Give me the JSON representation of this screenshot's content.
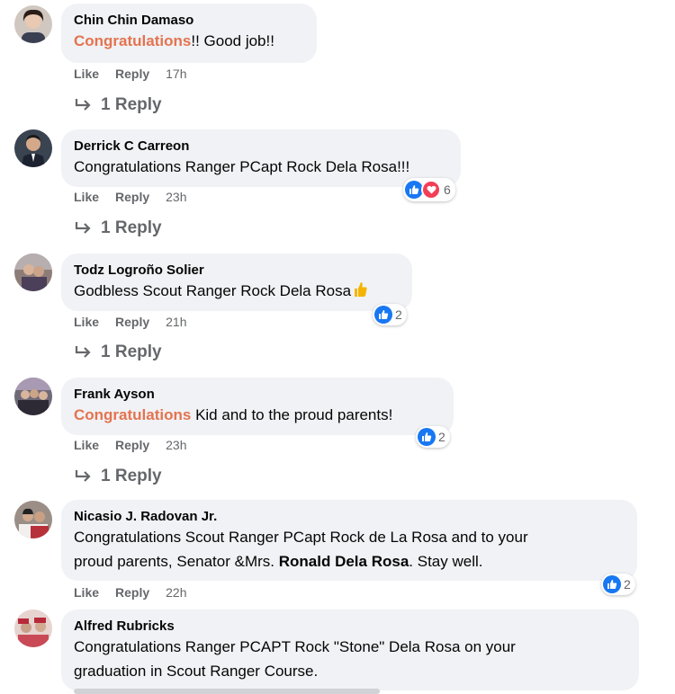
{
  "comments": [
    {
      "author": "Chin Chin Damaso",
      "text_highlight": "Congratulations",
      "text_rest": "!! Good job!!",
      "like": "Like",
      "reply": "Reply",
      "time": "17h",
      "replies": "1 Reply"
    },
    {
      "author": "Derrick C Carreon",
      "text": "Congratulations Ranger PCapt Rock Dela Rosa!!!",
      "like": "Like",
      "reply": "Reply",
      "time": "23h",
      "reactions": "6",
      "replies": "1 Reply"
    },
    {
      "author": "Todz Logroño Solier",
      "text": "Godbless Scout Ranger Rock Dela Rosa",
      "like": "Like",
      "reply": "Reply",
      "time": "21h",
      "reactions": "2",
      "replies": "1 Reply"
    },
    {
      "author": "Frank Ayson",
      "text_highlight": "Congratulations",
      "text_rest": " Kid and to the proud parents!",
      "like": "Like",
      "reply": "Reply",
      "time": "23h",
      "reactions": "2",
      "replies": "1 Reply"
    },
    {
      "author": "Nicasio J. Radovan Jr.",
      "line1": "Congratulations Scout Ranger PCapt Rock de La Rosa and to your",
      "line2_pre": "proud parents, Senator &Mrs. ",
      "line2_bold": "Ronald Dela Rosa",
      "line2_post": ". Stay well.",
      "like": "Like",
      "reply": "Reply",
      "time": "22h",
      "reactions": "2"
    },
    {
      "author": "Alfred Rubricks",
      "line1": "Congratulations Ranger PCAPT Rock \"Stone\" Dela Rosa on your",
      "line2": "graduation in Scout Ranger Course."
    }
  ],
  "colors": {
    "highlight": "#e4734f",
    "bubble": "#f0f2f5",
    "secondary_text": "#65676b",
    "like_blue": "#1877f2",
    "love_red": "#f33e58"
  }
}
